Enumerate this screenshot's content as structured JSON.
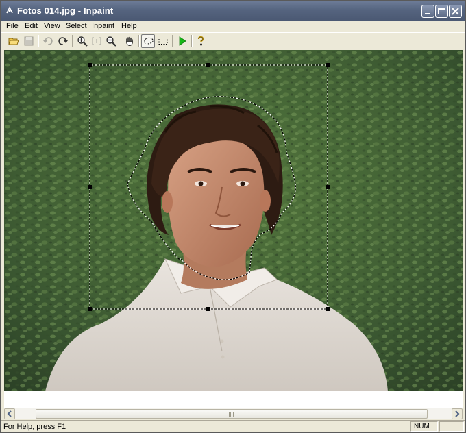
{
  "window": {
    "title": "Fotos 014.jpg - Inpaint",
    "controls": [
      "minimize-icon",
      "maximize-icon",
      "close-icon"
    ]
  },
  "menu": [
    {
      "underline": "F",
      "rest": "ile"
    },
    {
      "underline": "E",
      "rest": "dit"
    },
    {
      "underline": "V",
      "rest": "iew"
    },
    {
      "underline": "S",
      "rest": "elect"
    },
    {
      "underline": "I",
      "rest": "npaint"
    },
    {
      "underline": "H",
      "rest": "elp"
    }
  ],
  "toolbar": {
    "tools": [
      "open-folder-icon",
      "save-icon",
      "undo-icon",
      "redo-icon",
      "zoom-in-icon",
      "zoom-fit-icon",
      "zoom-out-icon",
      "hand-pan-icon",
      "lasso-select-icon",
      "rect-select-icon",
      "run-inpaint-icon",
      "help-icon"
    ],
    "active_tool": "lasso-select-icon",
    "disabled_tools": [
      "save-icon",
      "undo-icon",
      "zoom-fit-icon"
    ],
    "accent_run": "#17b817"
  },
  "status": {
    "text": "For Help, press F1",
    "num_indicator": "NUM",
    "extra_indicator": ""
  }
}
